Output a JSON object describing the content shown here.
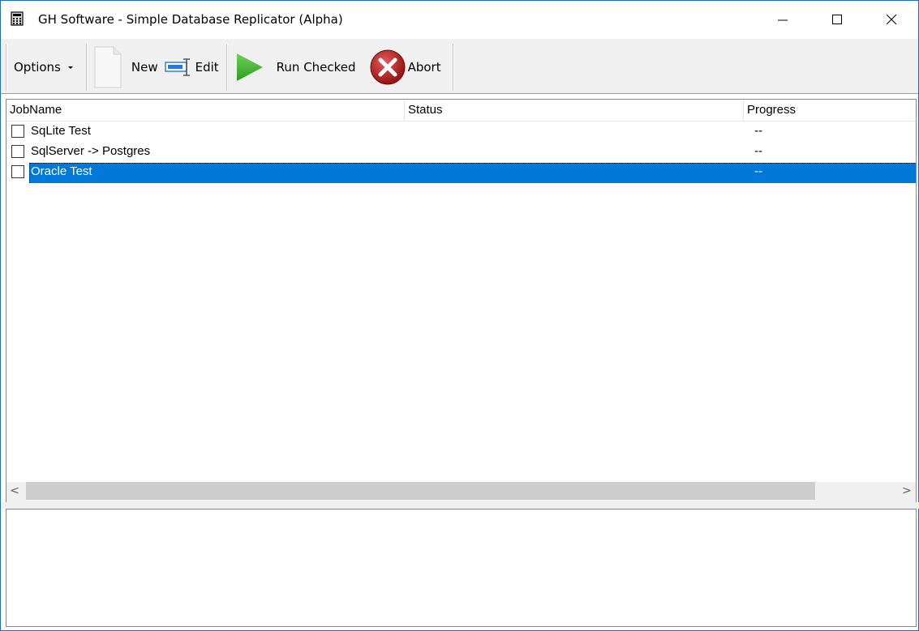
{
  "window": {
    "title": "GH Software - Simple Database Replicator (Alpha)",
    "controls": {
      "minimize_icon": "minimize-icon",
      "maximize_icon": "maximize-icon",
      "close_icon": "close-icon"
    }
  },
  "toolbar": {
    "options_label": "Options",
    "new_label": "New",
    "edit_label": "Edit",
    "run_label": "Run Checked",
    "abort_label": "Abort"
  },
  "list": {
    "columns": [
      "JobName",
      "Status",
      "Progress"
    ],
    "rows": [
      {
        "name": "SqLite Test",
        "status": "",
        "progress": "--",
        "checked": false,
        "selected": false
      },
      {
        "name": "SqlServer -> Postgres",
        "status": "",
        "progress": "--",
        "checked": false,
        "selected": false
      },
      {
        "name": "Oracle Test",
        "status": "",
        "progress": "--",
        "checked": false,
        "selected": true
      }
    ],
    "scroll_left": "<",
    "scroll_right": ">"
  },
  "colors": {
    "selection": "#0078d7",
    "accent_border": "#1e6fb8"
  }
}
